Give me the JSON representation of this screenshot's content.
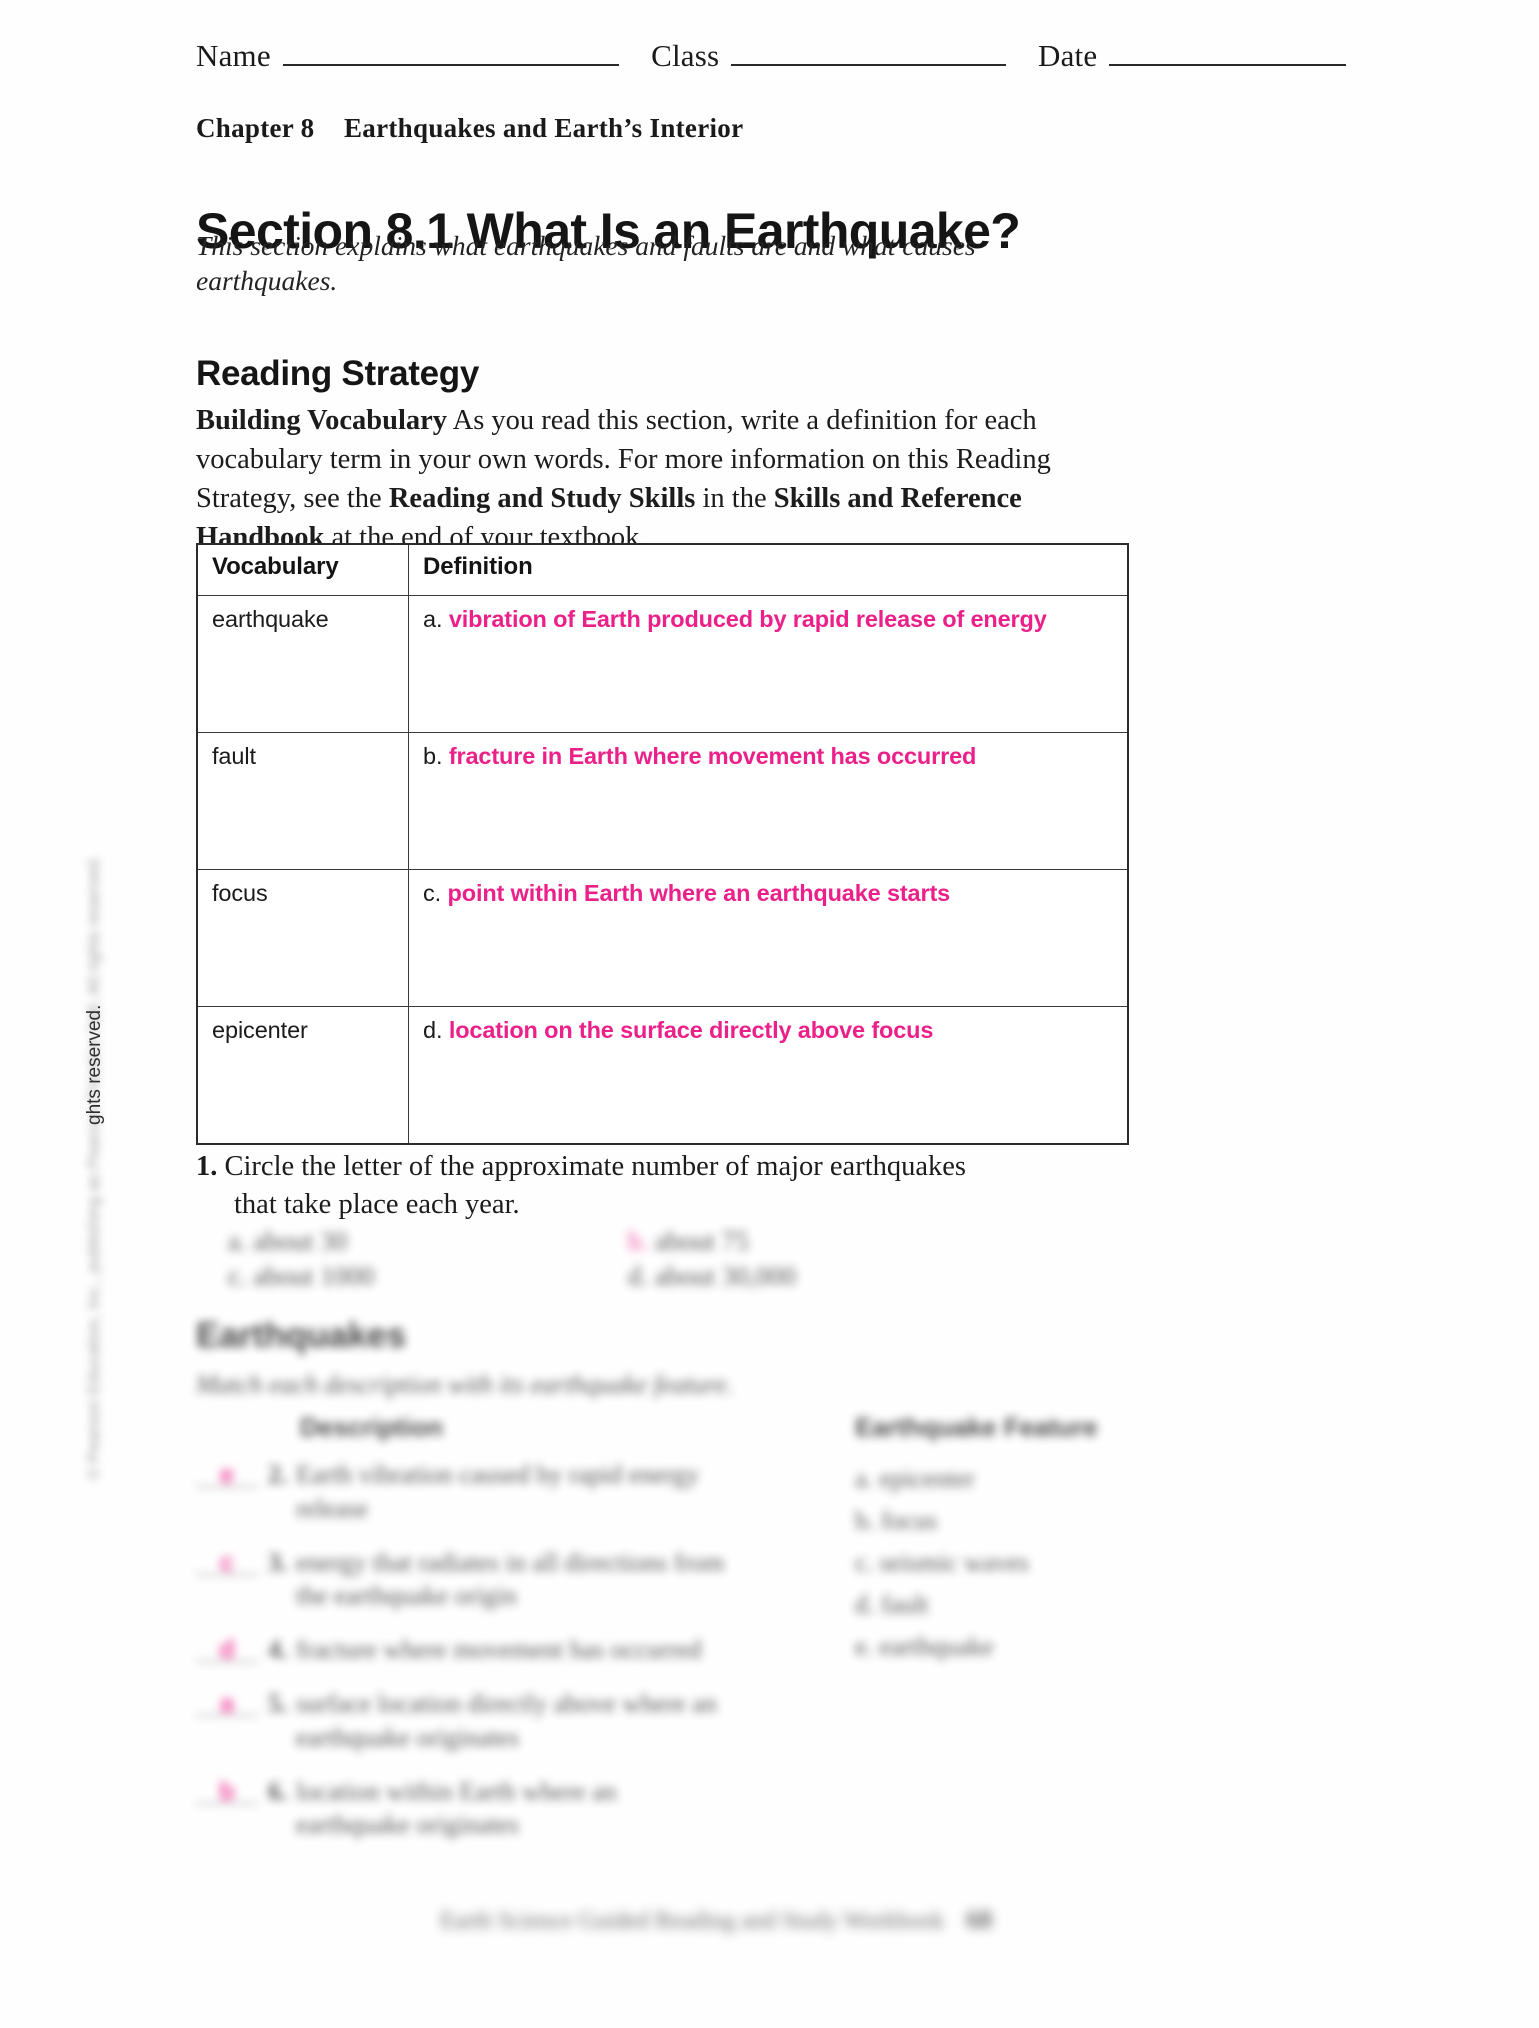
{
  "header": {
    "name_label": "Name",
    "class_label": "Class",
    "date_label": "Date"
  },
  "chapter": {
    "number_label": "Chapter 8",
    "title": "Earthquakes and Earth’s Interior"
  },
  "section": {
    "title": "Section 8.1 What Is an Earthquake?",
    "subtitle": "This section explains what earthquakes and faults are and what causes earthquakes."
  },
  "reading_strategy": {
    "heading": "Reading Strategy",
    "lead": "Building Vocabulary",
    "body_part1": " As you read this section, write a definition for each vocabulary term in your own words. For more information on this Reading Strategy, see the ",
    "bold1": "Reading and Study Skills",
    "body_part2": " in the ",
    "bold2": "Skills and Reference Handbook",
    "body_part3": " at the end of your textbook."
  },
  "vocab_table": {
    "columns": [
      "Vocabulary",
      "Definition"
    ],
    "rows": [
      {
        "term": "earthquake",
        "letter": "a.",
        "answer": "vibration of Earth produced by rapid release of energy"
      },
      {
        "term": "fault",
        "letter": "b.",
        "answer": "fracture in Earth where movement has occurred"
      },
      {
        "term": "focus",
        "letter": "c.",
        "answer": "point within Earth where an earthquake starts"
      },
      {
        "term": "epicenter",
        "letter": "d.",
        "answer": "location on the surface directly above focus"
      }
    ]
  },
  "question1": {
    "number": "1.",
    "line1": "Circle the letter of the approximate number of major earthquakes",
    "line2": "that take place each year.",
    "options": [
      {
        "letter": "a.",
        "text": "about 30",
        "selected": false
      },
      {
        "letter": "b.",
        "text": "about 75",
        "selected": true
      },
      {
        "letter": "c.",
        "text": "about 1000",
        "selected": false
      },
      {
        "letter": "d.",
        "text": "about 30,000",
        "selected": false
      }
    ]
  },
  "earthquakes_section": {
    "heading": "Earthquakes",
    "instruction": "Match each description with its earthquake feature.",
    "col_left_header": "Description",
    "col_right_header": "Earthquake Feature",
    "descriptions": [
      {
        "answer": "e",
        "number": "2.",
        "text": "Earth vibration caused by rapid energy release"
      },
      {
        "answer": "c",
        "number": "3.",
        "text": "energy that radiates in all directions from the earthquake origin"
      },
      {
        "answer": "d",
        "number": "4.",
        "text": "fracture where movement has occurred"
      },
      {
        "answer": "a",
        "number": "5.",
        "text": "surface location directly above where an earthquake originates"
      },
      {
        "answer": "b",
        "number": "6.",
        "text": "location within Earth where an earthquake originates"
      }
    ],
    "features": [
      {
        "letter": "a.",
        "text": "epicenter"
      },
      {
        "letter": "b.",
        "text": "focus"
      },
      {
        "letter": "c.",
        "text": "seismic waves"
      },
      {
        "letter": "d.",
        "text": "fault"
      },
      {
        "letter": "e.",
        "text": "earthquake"
      }
    ]
  },
  "footer": {
    "title": "Earth Science Guided Reading and Study Workbook",
    "page": "68"
  },
  "side_copyright": {
    "visible_text": "ghts reserved.",
    "blurred_text": "© Pearson Education, Inc., publishing as Pearson Prentice Hall. All rights reserved."
  },
  "colors": {
    "answer_pink": "#EC2089",
    "text": "#1a1a1a",
    "rule": "#2a2a2a"
  }
}
